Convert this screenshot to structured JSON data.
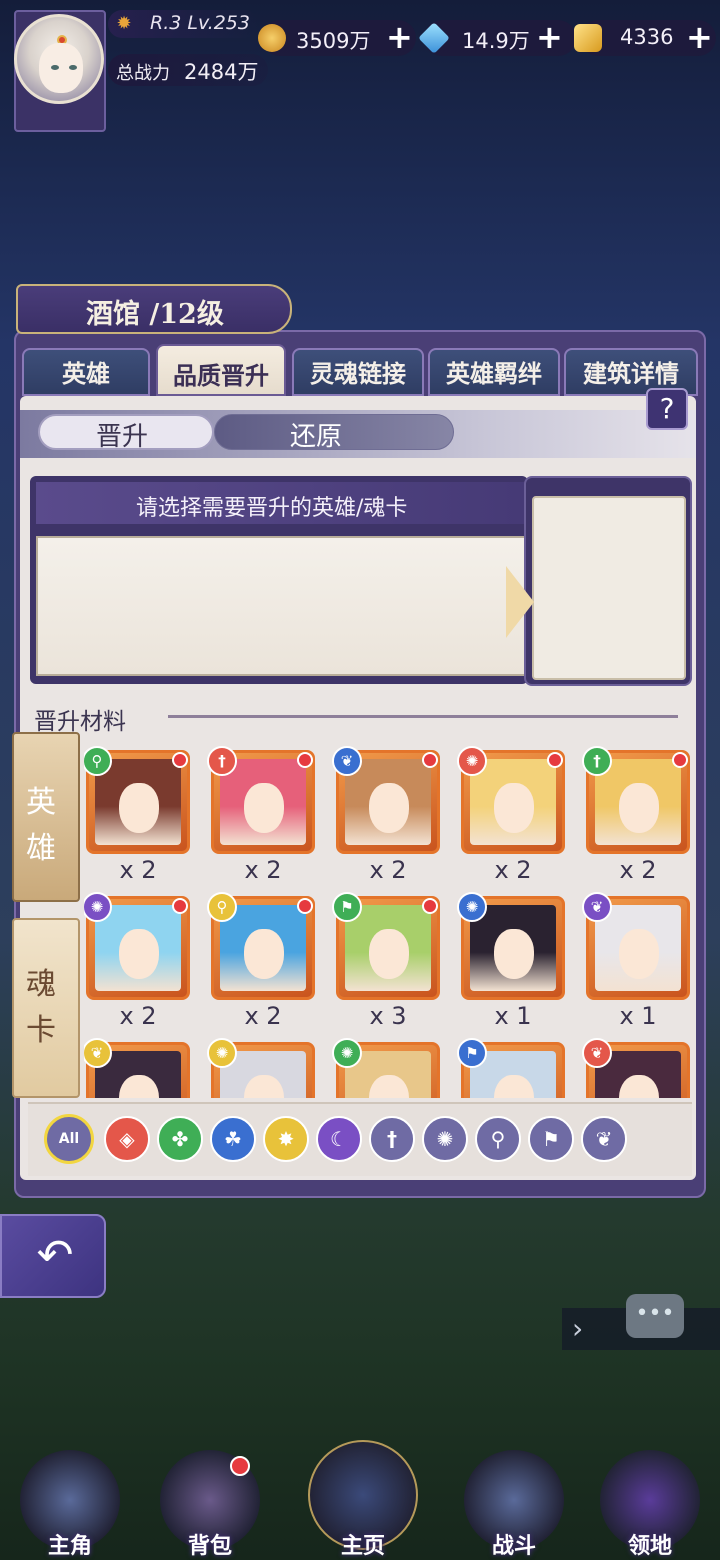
{
  "player": {
    "rank_level": "R.3 Lv.253",
    "power_label": "总战力",
    "power_value": "2484万"
  },
  "resources": [
    {
      "name": "gold-coin-icon",
      "value": "3509万",
      "color": "#e2a535"
    },
    {
      "name": "diamond-icon",
      "value": "14.9万",
      "color": "#4fb6e8"
    },
    {
      "name": "crystal-icon",
      "value": "4336",
      "color": "#e8b93a"
    }
  ],
  "panel": {
    "title": "酒馆 /12级",
    "help": "?",
    "tabs": [
      {
        "label": "英雄"
      },
      {
        "label": "品质晋升"
      },
      {
        "label": "灵魂链接"
      },
      {
        "label": "英雄羁绊"
      },
      {
        "label": "建筑详情"
      }
    ],
    "subtabs": [
      {
        "label": "晋升"
      },
      {
        "label": "还原"
      }
    ],
    "prompt": "请选择需要晋升的英雄/魂卡",
    "materials_label": "晋升材料",
    "side_tabs": [
      {
        "label": "英雄"
      },
      {
        "label": "魂卡"
      }
    ]
  },
  "heroes": [
    {
      "element": "magnifier-icon",
      "elem_color": "#3fae56",
      "count": "x 2",
      "hair": "#7a3a2e",
      "dot": true
    },
    {
      "element": "dagger-icon",
      "elem_color": "#e4574a",
      "count": "x 2",
      "hair": "#e6607a",
      "dot": true
    },
    {
      "element": "wings-icon",
      "elem_color": "#3a6fd0",
      "count": "x 2",
      "hair": "#c78a5a",
      "dot": true
    },
    {
      "element": "shuriken-icon",
      "elem_color": "#e4574a",
      "count": "x 2",
      "hair": "#f3d27a",
      "dot": true
    },
    {
      "element": "dagger-icon",
      "elem_color": "#3fae56",
      "count": "x 2",
      "hair": "#f0c766",
      "dot": true
    },
    {
      "element": "shuriken-icon",
      "elem_color": "#7a4fc4",
      "count": "x 2",
      "hair": "#8fd4f0",
      "dot": true
    },
    {
      "element": "magnifier-icon",
      "elem_color": "#e8c23a",
      "count": "x 2",
      "hair": "#4aa4e0",
      "dot": true
    },
    {
      "element": "flag-icon",
      "elem_color": "#3fae56",
      "count": "x 3",
      "hair": "#a8cf6a",
      "dot": true
    },
    {
      "element": "shuriken-icon",
      "elem_color": "#3a6fd0",
      "count": "x 1",
      "hair": "#2a2230",
      "dot": false
    },
    {
      "element": "wings-icon",
      "elem_color": "#7a4fc4",
      "count": "x 1",
      "hair": "#e8e6ea",
      "dot": false
    },
    {
      "element": "wings-icon",
      "elem_color": "#e8c23a",
      "count": "",
      "hair": "#3a2a3e",
      "dot": false
    },
    {
      "element": "shuriken-icon",
      "elem_color": "#e8c23a",
      "count": "",
      "hair": "#d8d8e0",
      "dot": false
    },
    {
      "element": "shuriken-icon",
      "elem_color": "#3fae56",
      "count": "",
      "hair": "#e8c78a",
      "dot": false
    },
    {
      "element": "flag-icon",
      "elem_color": "#3a6fd0",
      "count": "",
      "hair": "#c8d8e8",
      "dot": false
    },
    {
      "element": "wings-icon",
      "elem_color": "#e4574a",
      "count": "",
      "hair": "#4a2a3e",
      "dot": false
    }
  ],
  "filters": [
    {
      "name": "filter-all",
      "label": "All",
      "color": "#6f6ba4",
      "glyph": ""
    },
    {
      "name": "filter-fire-icon",
      "label": "",
      "color": "#e4574a",
      "glyph": "◈"
    },
    {
      "name": "filter-nature-icon",
      "label": "",
      "color": "#3fae56",
      "glyph": "✤"
    },
    {
      "name": "filter-water-icon",
      "label": "",
      "color": "#3a6fd0",
      "glyph": "☘"
    },
    {
      "name": "filter-light-icon",
      "label": "",
      "color": "#e8c23a",
      "glyph": "✸"
    },
    {
      "name": "filter-dark-icon",
      "label": "",
      "color": "#7a4fc4",
      "glyph": "☾"
    },
    {
      "name": "filter-dagger-icon",
      "label": "",
      "color": "#6f6ba4",
      "glyph": "†"
    },
    {
      "name": "filter-shuriken-icon",
      "label": "",
      "color": "#6f6ba4",
      "glyph": "✺"
    },
    {
      "name": "filter-magnifier-icon",
      "label": "",
      "color": "#6f6ba4",
      "glyph": "⚲"
    },
    {
      "name": "filter-flag-icon",
      "label": "",
      "color": "#6f6ba4",
      "glyph": "⚑"
    },
    {
      "name": "filter-wings-icon",
      "label": "",
      "color": "#6f6ba4",
      "glyph": "❦"
    }
  ],
  "nav": [
    {
      "label": "主角",
      "icon": "hooded-figure-icon"
    },
    {
      "label": "背包",
      "icon": "backpack-icon"
    },
    {
      "label": "主页",
      "icon": "book-icon"
    },
    {
      "label": "战斗",
      "icon": "crossed-swords-icon"
    },
    {
      "label": "领地",
      "icon": "castle-icon"
    }
  ]
}
